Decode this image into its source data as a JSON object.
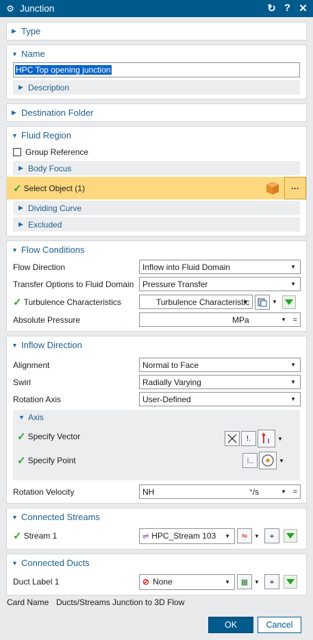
{
  "window": {
    "title": "Junction",
    "title_icon": "gear-icon"
  },
  "sections": {
    "type": "Type",
    "name": "Name",
    "name_value": "HPC Top opening junction",
    "description": "Description",
    "destination": "Destination Folder",
    "fluid_region": "Fluid Region",
    "group_reference": "Group Reference",
    "body_focus": "Body Focus",
    "select_object": "Select Object (1)",
    "dividing_curve": "Dividing Curve",
    "excluded": "Excluded",
    "flow_conditions": "Flow Conditions",
    "flow_direction": "Flow Direction",
    "flow_direction_value": "Inflow into Fluid Domain",
    "transfer_options": "Transfer Options to Fluid Domain",
    "transfer_options_value": "Pressure Transfer",
    "turbulence": "Turbulence Characteristics",
    "turbulence_value": "Turbulence Characteristic",
    "absolute_pressure": "Absolute Pressure",
    "absolute_pressure_unit": "MPa",
    "inflow_direction": "Inflow Direction",
    "alignment": "Alignment",
    "alignment_value": "Normal to Face",
    "swirl": "Swirl",
    "swirl_value": "Radially Varying",
    "rotation_axis": "Rotation Axis",
    "rotation_axis_value": "User-Defined",
    "axis": "Axis",
    "specify_vector": "Specify Vector",
    "specify_point": "Specify Point",
    "rotation_velocity": "Rotation Velocity",
    "rotation_velocity_value": "NH",
    "rotation_velocity_unit": "°/s",
    "connected_streams": "Connected Streams",
    "stream_1": "Stream 1",
    "stream_1_value": "HPC_Stream 103",
    "connected_ducts": "Connected Ducts",
    "duct_label_1": "Duct Label 1",
    "duct_label_1_value": "None"
  },
  "footer": {
    "card_name_label": "Card Name",
    "card_name_value": "Ducts/Streams Junction to 3D Flow",
    "ok": "OK",
    "cancel": "Cancel"
  },
  "colors": {
    "titlebar": "#005a8c",
    "accent": "#1f5f8b",
    "highlight": "#fdd87e",
    "check": "#32a232"
  }
}
